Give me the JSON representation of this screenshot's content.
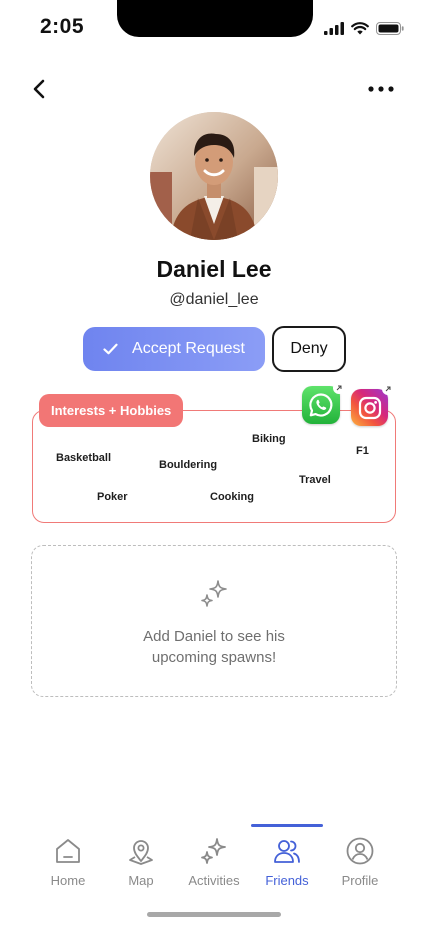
{
  "status_bar": {
    "time": "2:05"
  },
  "profile": {
    "name": "Daniel Lee",
    "handle": "@daniel_lee"
  },
  "actions": {
    "accept_label": "Accept Request",
    "deny_label": "Deny"
  },
  "interests": {
    "title": "Interests + Hobbies",
    "items": [
      "Basketball",
      "Bouldering",
      "Biking",
      "F1",
      "Travel",
      "Poker",
      "Cooking"
    ]
  },
  "socials": [
    {
      "name": "whatsapp",
      "icon": "whatsapp-icon"
    },
    {
      "name": "instagram",
      "icon": "instagram-icon"
    }
  ],
  "spawns": {
    "message": "Add Daniel to see his upcoming spawns!"
  },
  "tabs": [
    {
      "label": "Home",
      "icon": "home-icon"
    },
    {
      "label": "Map",
      "icon": "map-pin-icon"
    },
    {
      "label": "Activities",
      "icon": "sparkles-icon"
    },
    {
      "label": "Friends",
      "icon": "friends-icon",
      "active": true
    },
    {
      "label": "Profile",
      "icon": "profile-icon"
    }
  ],
  "colors": {
    "accent": "#4461d8",
    "accept_gradient_start": "#6f84ef",
    "interests_tag": "#f27675",
    "interests_border": "#f07a78",
    "inactive_tab": "#8a8a8a"
  }
}
